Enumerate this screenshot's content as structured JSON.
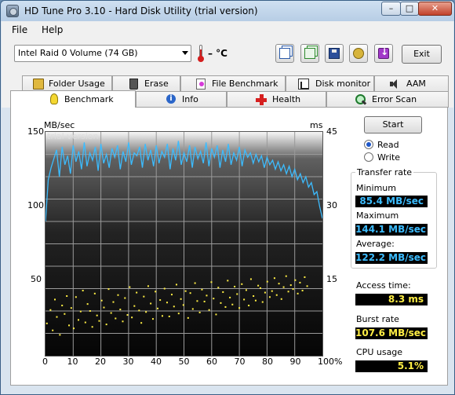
{
  "window": {
    "title": "HD Tune Pro 3.10 - Hard Disk Utility (trial version)",
    "min_label": "–",
    "max_label": "□",
    "close_label": "✕"
  },
  "menu": {
    "file": "File",
    "help": "Help"
  },
  "toolbar": {
    "drive": "Intel   Raid 0 Volume (74 GB)",
    "temperature": "– °C",
    "exit_label": "Exit"
  },
  "tabs_top": [
    "Folder Usage",
    "Erase",
    "File Benchmark",
    "Disk monitor",
    "AAM"
  ],
  "tabs_bottom": [
    "Benchmark",
    "Info",
    "Health",
    "Error Scan"
  ],
  "active_tab": "Benchmark",
  "controls": {
    "start_label": "Start",
    "read_label": "Read",
    "write_label": "Write",
    "selected_mode": "Read"
  },
  "stats": {
    "transfer_rate_title": "Transfer rate",
    "minimum_label": "Minimum",
    "minimum_value": "85.4 MB/sec",
    "maximum_label": "Maximum",
    "maximum_value": "144.1 MB/sec",
    "average_label": "Average:",
    "average_value": "122.2 MB/sec",
    "access_time_label": "Access time:",
    "access_time_value": "8.3 ms",
    "burst_rate_label": "Burst rate",
    "burst_rate_value": "107.6 MB/sec",
    "cpu_label": "CPU usage",
    "cpu_value": "5.1%"
  },
  "colors": {
    "transfer_line": "#3cbcff",
    "access_points": "#ffee44",
    "accent_blue": "#1e57c9"
  },
  "chart_data": {
    "type": "line",
    "watermark": "trial version",
    "y_left_unit": "MB/sec",
    "y_right_unit": "ms",
    "y_left_ticks": [
      "150",
      "100",
      "50"
    ],
    "y_right_ticks": [
      "45",
      "30",
      "15"
    ],
    "y_left_range": [
      0,
      150
    ],
    "y_right_range": [
      0,
      45
    ],
    "x_ticks": [
      "0",
      "10",
      "20",
      "30",
      "40",
      "50",
      "60",
      "70",
      "80",
      "90",
      "100%"
    ],
    "x_range": [
      0,
      100
    ],
    "grid": true,
    "series": [
      {
        "kind": "transfer_rate",
        "x": [
          0,
          1,
          2,
          3,
          4,
          5,
          6,
          7,
          8,
          9,
          10,
          11,
          12,
          13,
          14,
          15,
          16,
          17,
          18,
          19,
          20,
          21,
          22,
          23,
          24,
          25,
          26,
          27,
          28,
          29,
          30,
          31,
          32,
          33,
          34,
          35,
          36,
          37,
          38,
          39,
          40,
          41,
          42,
          43,
          44,
          45,
          46,
          47,
          48,
          49,
          50,
          51,
          52,
          53,
          54,
          55,
          56,
          57,
          58,
          59,
          60,
          61,
          62,
          63,
          64,
          65,
          66,
          67,
          68,
          69,
          70,
          71,
          72,
          73,
          74,
          75,
          76,
          77,
          78,
          79,
          80,
          81,
          82,
          83,
          84,
          85,
          86,
          87,
          88,
          89,
          90,
          91,
          92,
          93,
          94,
          95,
          96,
          97,
          98,
          99,
          100
        ],
        "values": [
          90,
          118,
          126,
          132,
          138,
          120,
          140,
          128,
          134,
          122,
          141,
          130,
          137,
          125,
          143,
          127,
          136,
          131,
          140,
          124,
          142,
          129,
          135,
          126,
          139,
          133,
          141,
          125,
          137,
          130,
          143,
          128,
          136,
          134,
          140,
          126,
          142,
          131,
          138,
          127,
          141,
          129,
          137,
          133,
          142,
          125,
          139,
          131,
          144,
          128,
          136,
          130,
          141,
          126,
          140,
          132,
          137,
          129,
          143,
          127,
          139,
          133,
          141,
          126,
          138,
          130,
          142,
          128,
          136,
          131,
          140,
          127,
          138,
          133,
          136,
          129,
          135,
          130,
          134,
          126,
          133,
          128,
          131,
          125,
          130,
          124,
          128,
          122,
          127,
          120,
          125,
          118,
          122,
          116,
          120,
          113,
          116,
          108,
          110,
          100,
          92
        ]
      },
      {
        "kind": "access_time_ms",
        "x": [
          0.5,
          1.8,
          2.6,
          3.4,
          4.1,
          5.2,
          6.0,
          6.9,
          7.7,
          8.5,
          9.3,
          10.2,
          11.0,
          11.9,
          12.7,
          13.5,
          14.4,
          15.2,
          16.1,
          16.9,
          17.8,
          18.6,
          19.4,
          20.3,
          21.1,
          22.0,
          22.8,
          23.7,
          24.5,
          25.3,
          26.2,
          27.0,
          27.9,
          28.7,
          29.6,
          30.4,
          31.2,
          32.1,
          32.9,
          33.8,
          34.6,
          35.5,
          36.3,
          37.1,
          38.0,
          38.8,
          39.7,
          40.5,
          41.4,
          42.2,
          43.0,
          43.9,
          44.7,
          45.6,
          46.4,
          47.3,
          48.1,
          48.9,
          49.8,
          50.6,
          51.5,
          52.3,
          53.2,
          54.0,
          54.8,
          55.7,
          56.5,
          57.4,
          58.2,
          59.1,
          59.9,
          60.7,
          61.6,
          62.4,
          63.3,
          64.1,
          65.0,
          65.8,
          66.6,
          67.5,
          68.3,
          69.2,
          70.0,
          70.9,
          71.7,
          72.5,
          73.4,
          74.2,
          75.1,
          75.9,
          76.8,
          77.6,
          78.4,
          79.3,
          80.1,
          81.0,
          81.8,
          82.7,
          83.5,
          84.3,
          85.2,
          86.0,
          86.9,
          87.7,
          88.6,
          89.4,
          90.2,
          91.1,
          91.9,
          92.8,
          93.6,
          94.5
        ],
        "values": [
          6.5,
          9.2,
          5.1,
          11.3,
          7.8,
          4.2,
          10.1,
          8.4,
          12.0,
          6.1,
          9.6,
          5.5,
          11.8,
          7.2,
          8.9,
          13.1,
          6.7,
          10.4,
          9.0,
          5.8,
          12.5,
          8.1,
          7.0,
          11.1,
          9.7,
          6.3,
          13.4,
          8.6,
          10.8,
          7.5,
          12.2,
          9.3,
          6.9,
          11.6,
          8.2,
          13.8,
          7.7,
          10.0,
          12.7,
          9.1,
          6.6,
          11.9,
          8.8,
          14.0,
          10.5,
          7.4,
          12.9,
          9.5,
          11.2,
          8.0,
          13.5,
          10.7,
          7.9,
          12.3,
          9.9,
          14.3,
          8.5,
          11.4,
          10.2,
          13.0,
          7.6,
          12.6,
          9.4,
          14.6,
          11.0,
          8.7,
          13.3,
          10.9,
          12.1,
          9.2,
          14.8,
          11.5,
          8.3,
          13.7,
          10.6,
          12.8,
          9.8,
          15.1,
          11.7,
          10.3,
          13.9,
          12.4,
          9.6,
          14.4,
          11.3,
          13.2,
          10.1,
          15.4,
          12.0,
          11.1,
          14.1,
          13.6,
          10.8,
          12.7,
          14.9,
          11.8,
          13.0,
          15.6,
          12.2,
          14.5,
          11.4,
          13.8,
          16.0,
          12.9,
          14.2,
          13.4,
          15.2,
          12.5,
          14.7,
          13.1,
          15.8,
          14.0
        ]
      }
    ]
  }
}
